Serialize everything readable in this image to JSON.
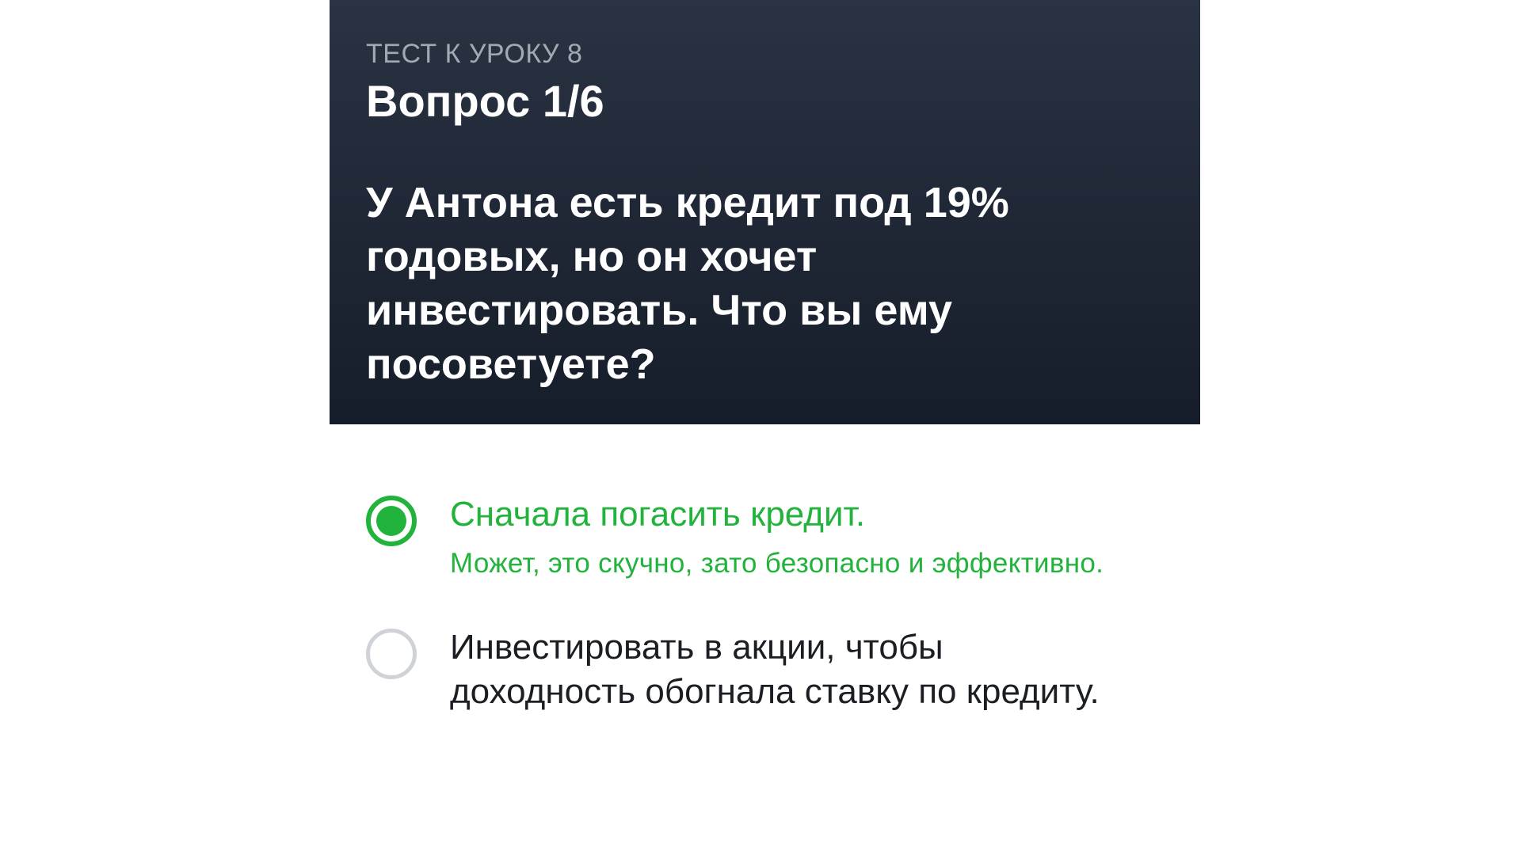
{
  "header": {
    "eyebrow": "ТЕСТ К УРОКУ 8",
    "question_number": "Вопрос 1/6",
    "question_text": "У Антона есть кредит под 19% годовых, но он хочет инвестировать. Что вы ему посоветуете?"
  },
  "options": [
    {
      "label": "Сначала погасить кредит.",
      "hint": "Может, это скучно, зато безопасно и эффективно.",
      "selected": true,
      "color": "#22b33c"
    },
    {
      "label": "Инвестировать в акции, чтобы доходность обогнала ставку по кредиту.",
      "selected": false
    }
  ],
  "colors": {
    "header_bg": "#1f2735",
    "accent_green": "#22b33c",
    "radio_border": "#cfd2d6"
  }
}
